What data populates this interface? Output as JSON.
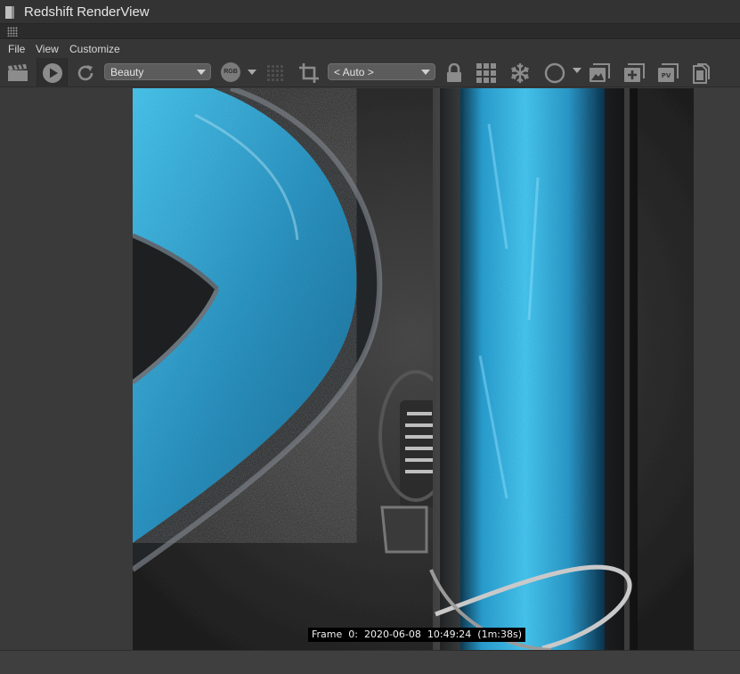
{
  "window": {
    "title": "Redshift RenderView"
  },
  "menu": {
    "items": [
      "File",
      "View",
      "Customize"
    ]
  },
  "toolbar": {
    "aov_dropdown": {
      "value": "Beauty"
    },
    "rgb_label": "RGB",
    "crop_dropdown": {
      "value": "< Auto >"
    }
  },
  "icons": [
    "clapperboard-icon",
    "play-icon",
    "refresh-icon",
    "rgb-channel-icon",
    "dither-grid-icon",
    "crop-icon",
    "lock-icon",
    "bucket-grid-icon",
    "snowflake-icon",
    "circle-icon",
    "image-icon",
    "add-snapshot-icon",
    "pv-icon",
    "copy-icon"
  ],
  "render": {
    "frame_info": "Frame  0:  2020-06-08  10:49:24  (1m:38s)"
  },
  "colors": {
    "accent_cyan": "#36b6e6",
    "toolbar_bg": "#363636",
    "dropdown_bg": "#5c5c5c"
  }
}
